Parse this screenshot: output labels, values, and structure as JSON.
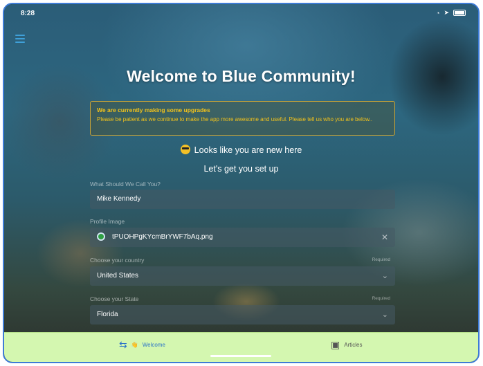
{
  "status_bar": {
    "time": "8:28"
  },
  "header": {
    "title": "Welcome to Blue Community!"
  },
  "notice": {
    "title": "We are currently making some upgrades",
    "body": "Please be patient as we continue to make the app more awesome and useful.  Please tell us who you are below.."
  },
  "intro": {
    "new_here": "Looks like you are new here",
    "setup": "Let's get you set up"
  },
  "form": {
    "name": {
      "label": "What Should We Call You?",
      "value": "Mike Kennedy"
    },
    "profile_image": {
      "label": "Profile Image",
      "file_name": "tPUOHPgKYcmBrYWF7bAq.png"
    },
    "country": {
      "label": "Choose your country",
      "required": "Required",
      "value": "United States"
    },
    "state": {
      "label": "Choose your State",
      "required": "Required",
      "value": "Florida"
    }
  },
  "tabs": [
    {
      "label": "Welcome",
      "selected": true
    },
    {
      "label": "Articles",
      "selected": false
    }
  ],
  "colors": {
    "accent": "#2b73c8",
    "notice": "#f2c21b",
    "tabbar": "#d4f7b0",
    "device_border": "#3d7bd6"
  }
}
